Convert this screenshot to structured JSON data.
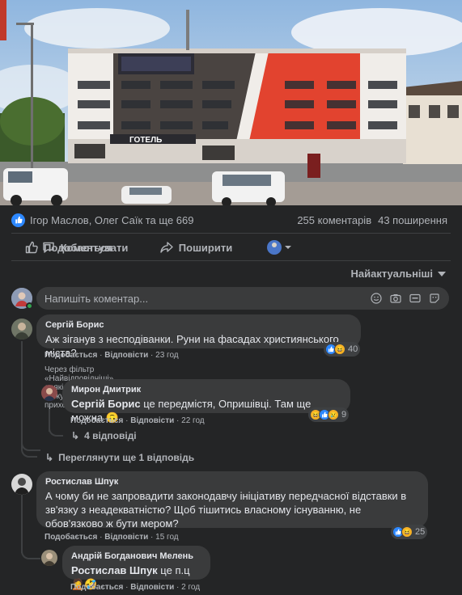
{
  "post": {
    "reactions_text": "Ігор Маслов, Олег Саїк та ще 669",
    "comments_count": "255 коментарів",
    "shares_count": "43 поширення",
    "hotel_sign": "ГОТЕЛЬ"
  },
  "actions": {
    "like": "Подобається",
    "comment": "Коментувати",
    "share": "Поширити"
  },
  "sort": {
    "label": "Найактуальніші"
  },
  "composer": {
    "placeholder": "Напишіть коментар..."
  },
  "comments": [
    {
      "author": "Сергій Борис",
      "text": "Аж зіганув з несподіванки. Руни на фасадах християнського міста?",
      "like_label": "Подобається",
      "reply_label": "Відповісти",
      "time": "23 год",
      "reactions_count": "40",
      "filter_note": "Через фільтр «Найвідповідніші» деякі відповіді можуть бути приховані.",
      "reply": {
        "author": "Мирон Дмитрик",
        "mention": "Сергій Борис",
        "text": " це передмістя, Опришівці. Там ще можна 🙃",
        "like_label": "Подобається",
        "reply_label": "Відповісти",
        "time": "22 год",
        "reactions_count": "9"
      },
      "more_replies": "4 відповіді",
      "view_more": "Переглянути ще 1 відповідь"
    },
    {
      "author": "Ростислав Шпук",
      "text": "А чому би не запровадити законодавчу ініціативу передчасної відставки в зв'язку з неадекватністю? Щоб тішитись власному існуванню, не обов'язково ж бути мером?",
      "like_label": "Подобається",
      "reply_label": "Відповісти",
      "time": "15 год",
      "reactions_count": "25",
      "reply": {
        "author": "Андрій Богданович Мелень",
        "mention": "Ростислав Шпук",
        "text": " це п.ц🤦🤣",
        "like_label": "Подобається",
        "reply_label": "Відповісти",
        "time": "2 год"
      }
    }
  ],
  "colors": {
    "background": "#242526",
    "bubble": "#3a3b3c",
    "accent": "#2d88ff",
    "text": "#e4e6eb",
    "muted": "#b0b3b8"
  },
  "icons": [
    "like-icon",
    "comment-icon",
    "share-icon",
    "emoji-icon",
    "camera-icon",
    "gif-icon",
    "sticker-icon"
  ]
}
